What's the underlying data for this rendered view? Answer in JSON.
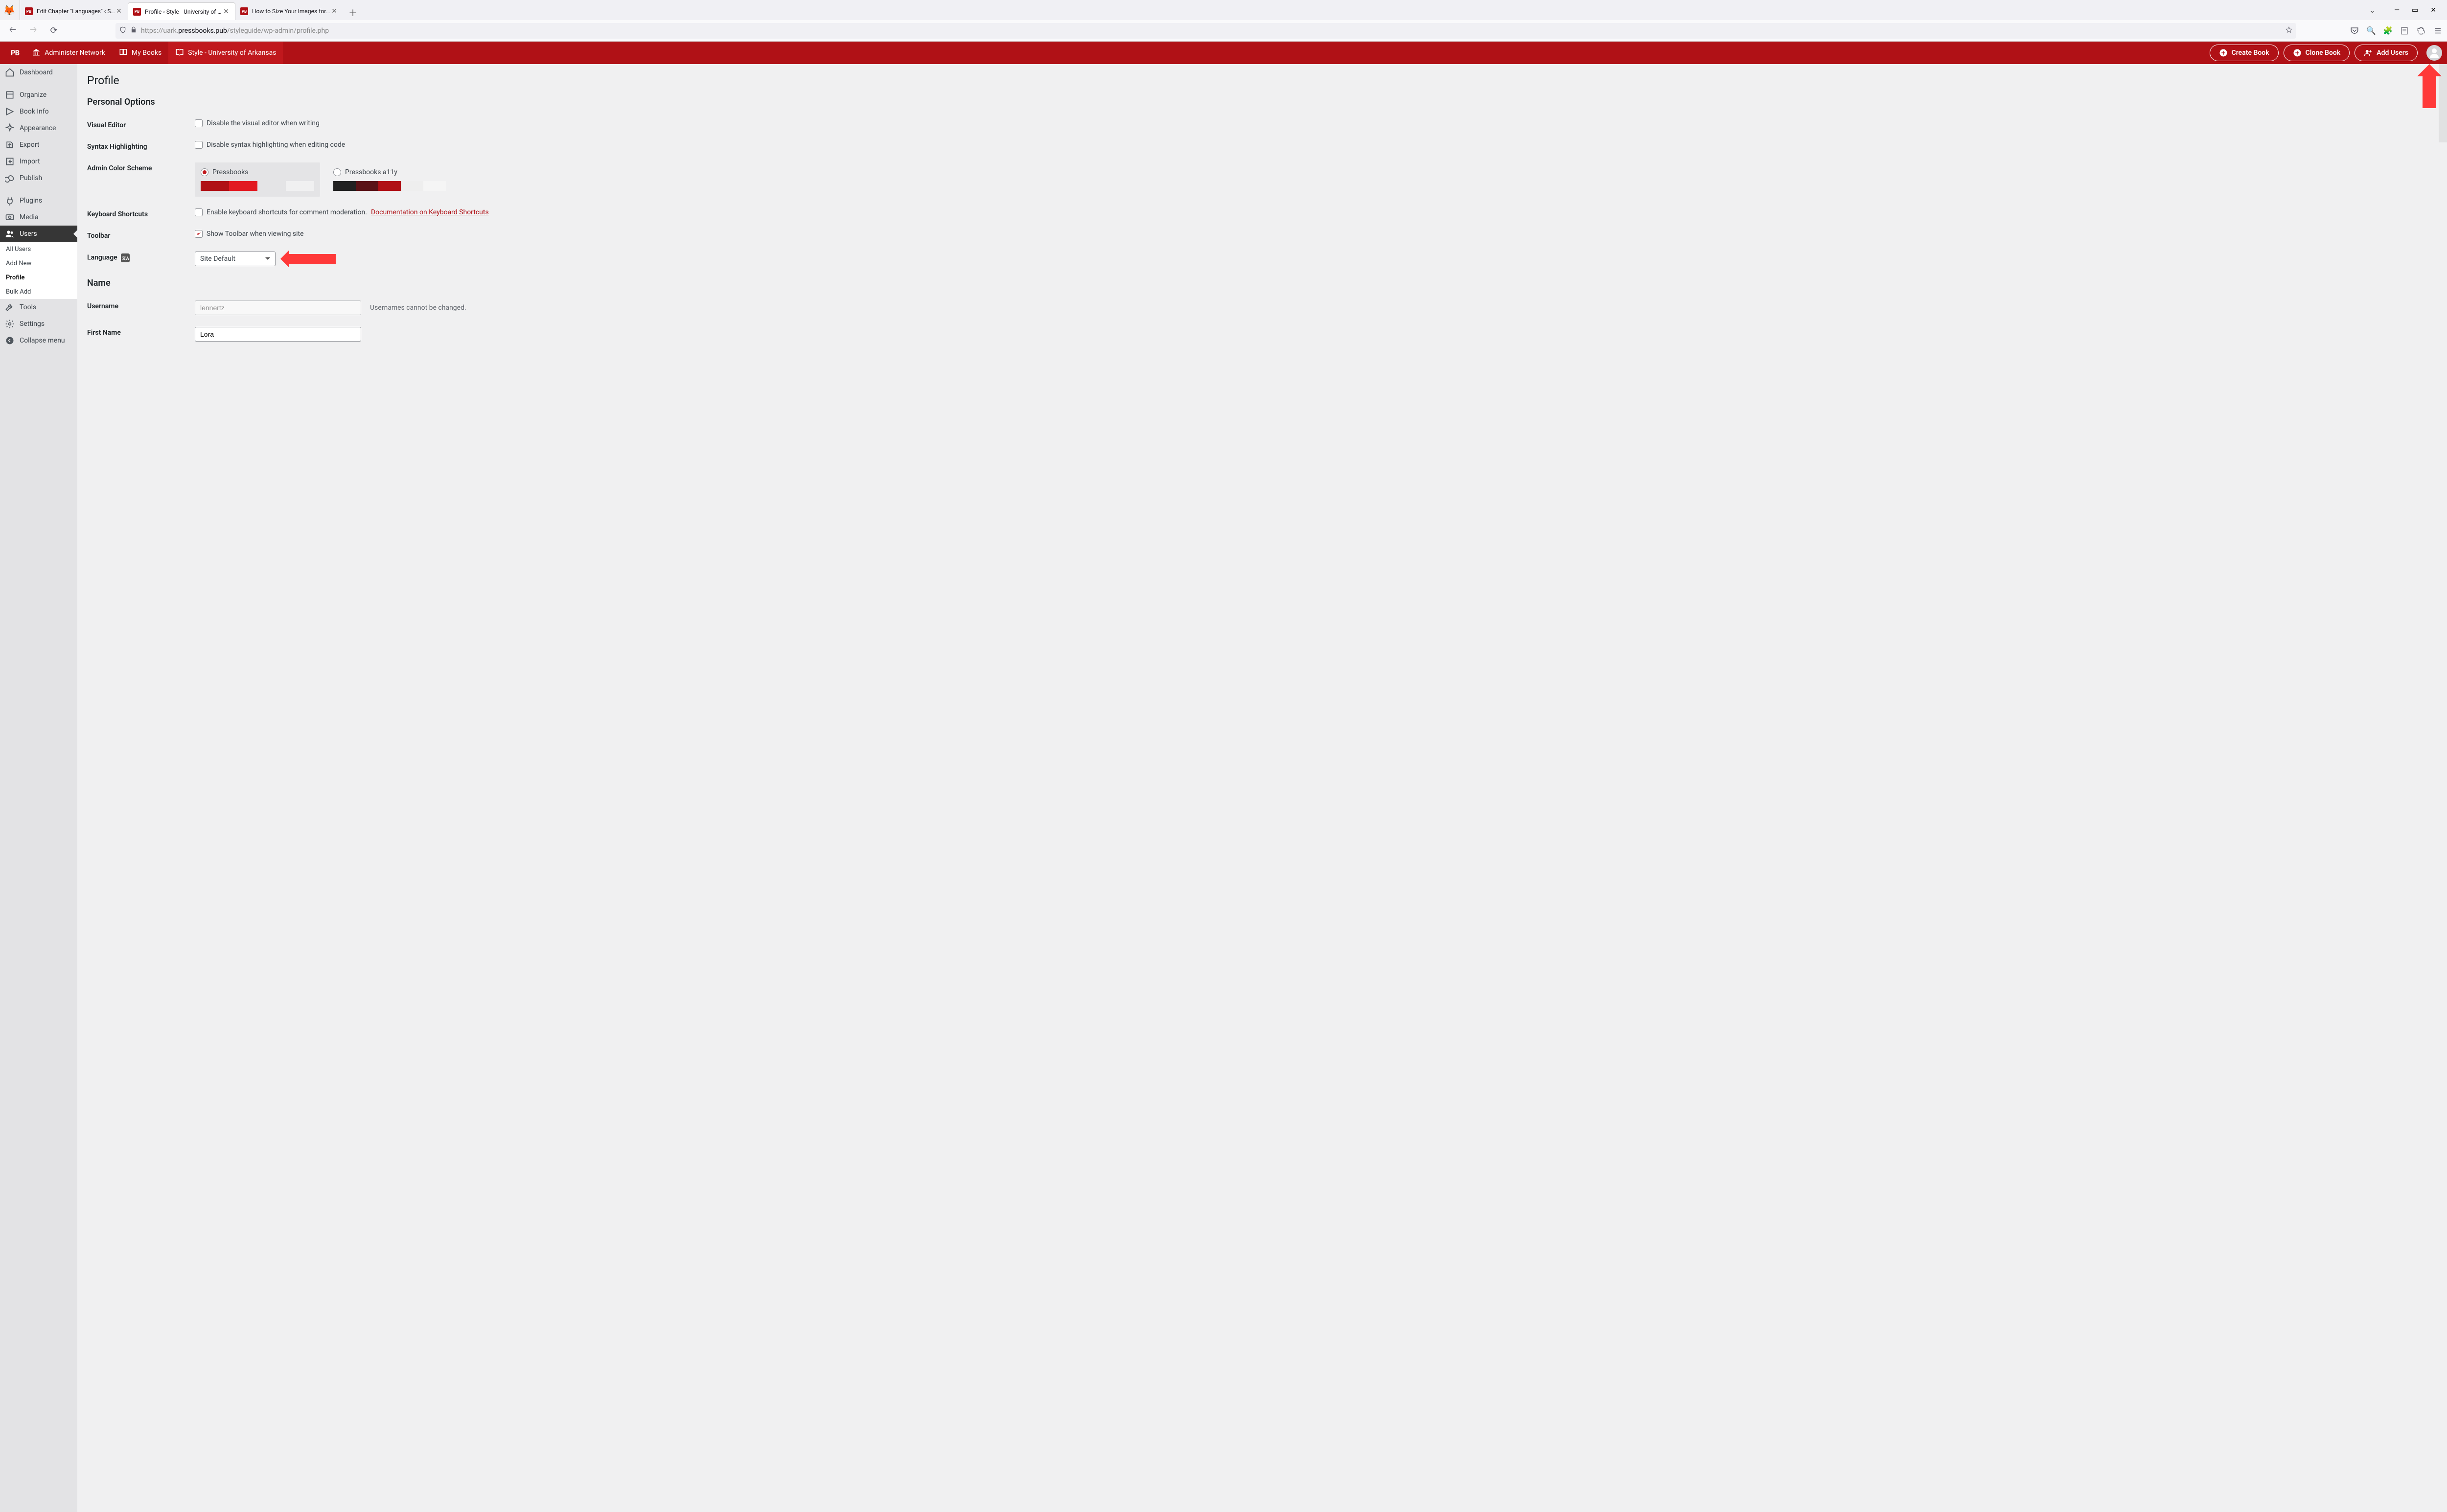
{
  "browser": {
    "tabs": [
      {
        "title": "Edit Chapter \"Languages\" ‹ Styl"
      },
      {
        "title": "Profile ‹ Style - University of Ar"
      },
      {
        "title": "How to Size Your Images for Pr"
      }
    ],
    "url_prefix": "https://uark.",
    "url_host": "pressbooks.pub",
    "url_path": "/styleguide/wp-admin/profile.php"
  },
  "topbar": {
    "admin_network": "Administer Network",
    "my_books": "My Books",
    "site": "Style - University of Arkansas",
    "create_book": "Create Book",
    "clone_book": "Clone Book",
    "add_users": "Add Users"
  },
  "sidebar": {
    "items": [
      "Dashboard",
      "Organize",
      "Book Info",
      "Appearance",
      "Export",
      "Import",
      "Publish",
      "Plugins",
      "Media",
      "Users",
      "Tools",
      "Settings",
      "Collapse menu"
    ],
    "sub": [
      "All Users",
      "Add New",
      "Profile",
      "Bulk Add"
    ]
  },
  "page": {
    "heading": "Profile",
    "section_personal": "Personal Options",
    "visual_editor_label": "Visual Editor",
    "visual_editor_text": "Disable the visual editor when writing",
    "syntax_label": "Syntax Highlighting",
    "syntax_text": "Disable syntax highlighting when editing code",
    "color_label": "Admin Color Scheme",
    "scheme1": "Pressbooks",
    "scheme2": "Pressbooks a11y",
    "keyboard_label": "Keyboard Shortcuts",
    "keyboard_text": "Enable keyboard shortcuts for comment moderation. ",
    "keyboard_link": "Documentation on Keyboard Shortcuts",
    "toolbar_label": "Toolbar",
    "toolbar_text": "Show Toolbar when viewing site",
    "language_label": "Language",
    "language_value": "Site Default",
    "section_name": "Name",
    "username_label": "Username",
    "username_value": "lennertz",
    "username_hint": "Usernames cannot be changed.",
    "firstname_label": "First Name",
    "firstname_value": "Lora"
  },
  "colors": {
    "scheme1": [
      "#b01116",
      "#e21a22",
      "#e4e4e6",
      "#f0f0f1"
    ],
    "scheme2": [
      "#222",
      "#5a1317",
      "#b01116",
      "#eee",
      "#f5f5f5"
    ]
  }
}
